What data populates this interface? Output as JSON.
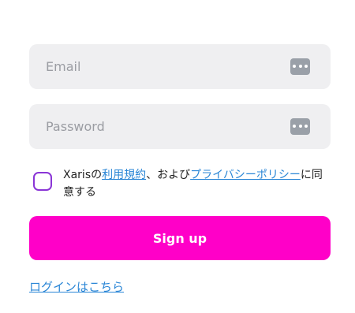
{
  "form": {
    "email": {
      "placeholder": "Email",
      "value": ""
    },
    "password": {
      "placeholder": "Password",
      "value": ""
    },
    "field_icon": "password-manager-icon",
    "consent": {
      "checked": false,
      "prefix": "Xarisの",
      "terms_link": "利用規約",
      "middle": "、および",
      "privacy_link": "プライバシーポリシー",
      "suffix": "に同意する"
    },
    "signup_label": "Sign up",
    "login_link": "ログインはこちら"
  },
  "colors": {
    "field_bg": "#efeff1",
    "accent": "#ff00c8",
    "checkbox_border": "#8a35d6",
    "link": "#2a86d6"
  }
}
